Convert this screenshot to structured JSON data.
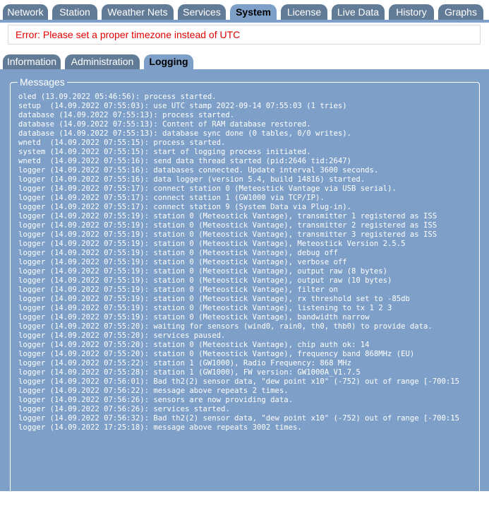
{
  "top_tabs": [
    {
      "label": "Network",
      "active": false
    },
    {
      "label": "Station",
      "active": false
    },
    {
      "label": "Weather Nets",
      "active": false
    },
    {
      "label": "Services",
      "active": false
    },
    {
      "label": "System",
      "active": true
    },
    {
      "label": "License",
      "active": false
    },
    {
      "label": "Live Data",
      "active": false
    },
    {
      "label": "History",
      "active": false
    },
    {
      "label": "Graphs",
      "active": false
    }
  ],
  "error_message": "Error: Please set a proper timezone instead of UTC",
  "sub_tabs": [
    {
      "label": "Information",
      "active": false
    },
    {
      "label": "Administration",
      "active": false
    },
    {
      "label": "Logging",
      "active": true
    }
  ],
  "messages_legend": "Messages",
  "log_lines": [
    "oled (13.09.2022 05:46:56): process started.",
    "setup  (14.09.2022 07:55:03): use UTC stamp 2022-09-14 07:55:03 (1 tries)",
    "database (14.09.2022 07:55:13): process started.",
    "database (14.09.2022 07:55:13): Content of RAM database restored.",
    "database (14.09.2022 07:55:13): database sync done (0 tables, 0/0 writes).",
    "wnetd  (14.09.2022 07:55:15): process started.",
    "system (14.09.2022 07:55:15): start of logging process initiated.",
    "wnetd  (14.09.2022 07:55:16): send data thread started (pid:2646 tid:2647)",
    "logger (14.09.2022 07:55:16): databases connected. Update interval 3600 seconds.",
    "logger (14.09.2022 07:55:16): data logger (version 5.4, build 14816) started.",
    "logger (14.09.2022 07:55:17): connect station 0 (Meteostick Vantage via USB serial).",
    "logger (14.09.2022 07:55:17): connect station 1 (GW1000 via TCP/IP).",
    "logger (14.09.2022 07:55:17): connect station 9 (System Data via Plug-in).",
    "logger (14.09.2022 07:55:19): station 0 (Meteostick Vantage), transmitter 1 registered as ISS",
    "logger (14.09.2022 07:55:19): station 0 (Meteostick Vantage), transmitter 2 registered as ISS",
    "logger (14.09.2022 07:55:19): station 0 (Meteostick Vantage), transmitter 3 registered as ISS",
    "logger (14.09.2022 07:55:19): station 0 (Meteostick Vantage), Meteostick Version 2.5.5",
    "logger (14.09.2022 07:55:19): station 0 (Meteostick Vantage), debug off",
    "logger (14.09.2022 07:55:19): station 0 (Meteostick Vantage), verbose off",
    "logger (14.09.2022 07:55:19): station 0 (Meteostick Vantage), output raw (8 bytes)",
    "logger (14.09.2022 07:55:19): station 0 (Meteostick Vantage), output raw (10 bytes)",
    "logger (14.09.2022 07:55:19): station 0 (Meteostick Vantage), filter on",
    "logger (14.09.2022 07:55:19): station 0 (Meteostick Vantage), rx threshold set to -85db",
    "logger (14.09.2022 07:55:19): station 0 (Meteostick Vantage), listening to tx 1 2 3",
    "logger (14.09.2022 07:55:19): station 0 (Meteostick Vantage), bandwidth narrow",
    "logger (14.09.2022 07:55:20): waiting for sensors (wind0, rain0, th0, thb0) to provide data.",
    "logger (14.09.2022 07:55:20): services paused.",
    "logger (14.09.2022 07:55:20): station 0 (Meteostick Vantage), chip auth ok: 14",
    "logger (14.09.2022 07:55:20): station 0 (Meteostick Vantage), frequency band 868MHz (EU)",
    "logger (14.09.2022 07:55:22): station 1 (GW1000), Radio Frequency: 868 MHz",
    "logger (14.09.2022 07:55:28): station 1 (GW1000), FW version: GW1000A_V1.7.5",
    "logger (14.09.2022 07:56:01): Bad th2(2) sensor data, \"dew point x10\" (-752) out of range [-700:15",
    "logger (14.09.2022 07:56:22): message above repeats 2 times.",
    "logger (14.09.2022 07:56:26): sensors are now providing data.",
    "logger (14.09.2022 07:56:26): services started.",
    "logger (14.09.2022 07:56:32): Bad th2(2) sensor data, \"dew point x10\" (-752) out of range [-700:15",
    "logger (14.09.2022 17:25:18): message above repeats 3002 times."
  ],
  "colors": {
    "tab_inactive": "#627b96",
    "tab_active": "#7ea0c8",
    "panel": "#7ea0c8",
    "error_text": "#e30000"
  }
}
